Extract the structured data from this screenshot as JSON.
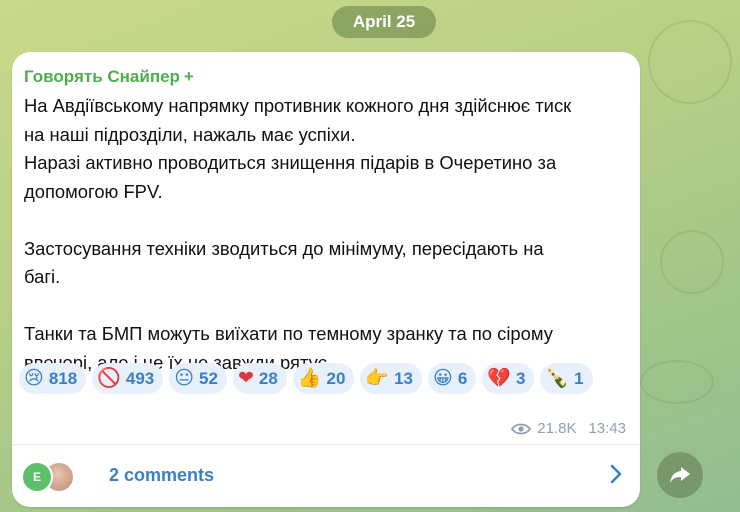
{
  "date": "April 25",
  "message": {
    "author": "Говорять Снайпер",
    "paragraphs": [
      [
        "На Авдіївському напрямку противник кожного дня здійснює тиск",
        "на наші підрозділи, нажаль має успіхи.",
        "Наразі активно проводиться знищення підарів в Очеретино за",
        "допомогою FPV."
      ],
      [
        "Застосування техніки зводиться до мінімуму, пересідають на",
        "багі."
      ],
      [
        "Танки та БМП можуть виїхати по темному зранку та по сірому",
        "ввечорі, але і це їх не завжди рятує."
      ]
    ],
    "reactions": [
      {
        "icon": "crying-face-icon",
        "glyph": "😢",
        "count": "818"
      },
      {
        "icon": "crossed-out-car-icon",
        "glyph": "🚫",
        "count": "493"
      },
      {
        "icon": "face-icon",
        "glyph": "😐",
        "count": "52"
      },
      {
        "icon": "red-heart-icon",
        "glyph": "❤",
        "count": "28"
      },
      {
        "icon": "thumbs-up-icon",
        "glyph": "👍",
        "count": "20"
      },
      {
        "icon": "pointing-hand-icon",
        "glyph": "👉",
        "count": "13"
      },
      {
        "icon": "grinning-face-icon",
        "glyph": "😀",
        "count": "6"
      },
      {
        "icon": "broken-heart-icon",
        "glyph": "💔",
        "count": "3"
      },
      {
        "icon": "champagne-bottle-icon",
        "glyph": "🍾",
        "count": "1"
      }
    ],
    "views": "21.8K",
    "time": "13:43",
    "comments": {
      "avatar_letter": "E",
      "label": "2 comments"
    }
  },
  "colors": {
    "author": "#4fae4e",
    "link": "#3a7fc7",
    "reaction_bg": "#e8f0fb",
    "bubble": "#ffffff",
    "meta": "#8fa0b0"
  }
}
